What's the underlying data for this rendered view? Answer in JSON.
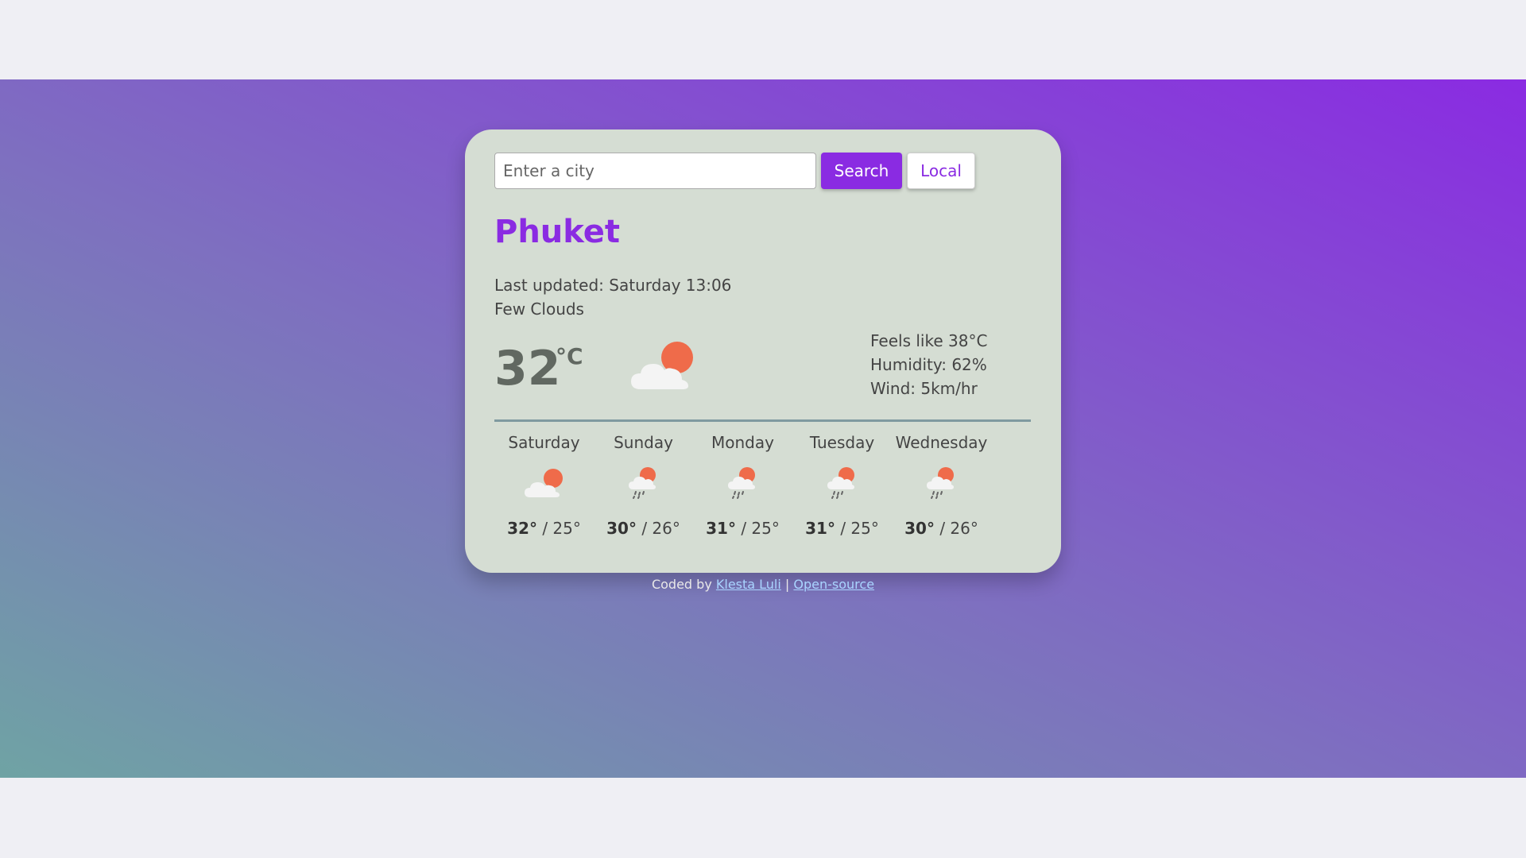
{
  "search": {
    "placeholder": "Enter a city",
    "search_label": "Search",
    "local_label": "Local"
  },
  "current": {
    "city": "Phuket",
    "last_updated": "Last updated: Saturday 13:06",
    "description": "Few Clouds",
    "temperature": "32",
    "unit": "°C",
    "icon": "few-clouds-icon",
    "feels_like": "Feels like 38°C",
    "humidity": "Humidity: 62%",
    "wind": "Wind: 5km/hr"
  },
  "forecast": [
    {
      "day": "Saturday",
      "high": "32°",
      "low": "25°",
      "icon": "few-clouds-icon"
    },
    {
      "day": "Sunday",
      "high": "30°",
      "low": "26°",
      "icon": "rain-sun-icon"
    },
    {
      "day": "Monday",
      "high": "31°",
      "low": "25°",
      "icon": "rain-sun-icon"
    },
    {
      "day": "Tuesday",
      "high": "31°",
      "low": "25°",
      "icon": "rain-sun-icon"
    },
    {
      "day": "Wednesday",
      "high": "30°",
      "low": "26°",
      "icon": "rain-sun-icon"
    }
  ],
  "footer": {
    "prefix": "Coded by",
    "author": "Klesta Luli",
    "separator": "|",
    "source": "Open-source"
  },
  "colors": {
    "accent": "#8a2be2",
    "card": "#d5ddd3",
    "sun": "#ef6b4a",
    "cloud": "#f4f4f4"
  }
}
